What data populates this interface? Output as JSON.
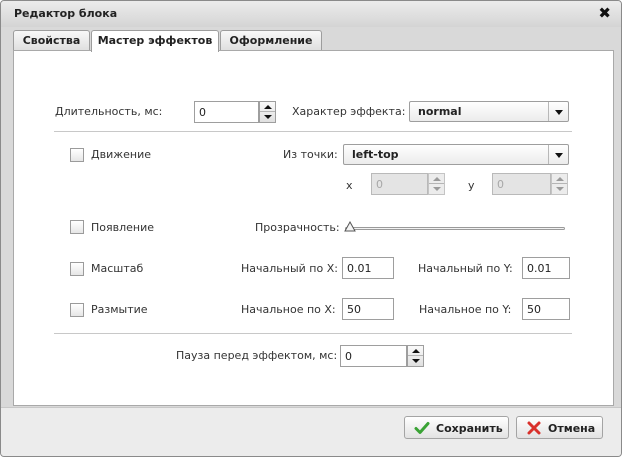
{
  "dialog": {
    "title": "Редактор блока",
    "close_glyph": "✖"
  },
  "tabs": [
    {
      "label": "Свойства",
      "active": false
    },
    {
      "label": "Мастер эффектов",
      "active": true
    },
    {
      "label": "Оформление",
      "active": false
    }
  ],
  "form": {
    "duration": {
      "label": "Длительность, мс:",
      "value": "0"
    },
    "effect_character": {
      "label": "Характер эффекта:",
      "value": "normal"
    },
    "movement": {
      "label": "Движение",
      "checked": false
    },
    "from_point": {
      "label": "Из точки:",
      "value": "left-top"
    },
    "x": {
      "label": "x",
      "value": "0",
      "disabled": true
    },
    "y": {
      "label": "y",
      "value": "0",
      "disabled": true
    },
    "appearance": {
      "label": "Появление",
      "checked": false
    },
    "opacity": {
      "label": "Прозрачность:",
      "level": 0
    },
    "scale": {
      "label": "Масштаб",
      "checked": false,
      "start_x_label": "Начальный по X:",
      "start_x_value": "0.01",
      "start_y_label": "Начальный по Y:",
      "start_y_value": "0.01"
    },
    "blur": {
      "label": "Размытие",
      "checked": false,
      "start_x_label": "Начальное по X:",
      "start_x_value": "50",
      "start_y_label": "Начальное по Y:",
      "start_y_value": "50"
    },
    "pause": {
      "label": "Пауза перед эффектом, мс:",
      "value": "0"
    }
  },
  "buttons": {
    "save": {
      "label": "Сохранить",
      "icon": "checkmark-icon",
      "color": "#3aa335"
    },
    "cancel": {
      "label": "Отмена",
      "icon": "cross-icon",
      "color": "#d9312b"
    }
  }
}
